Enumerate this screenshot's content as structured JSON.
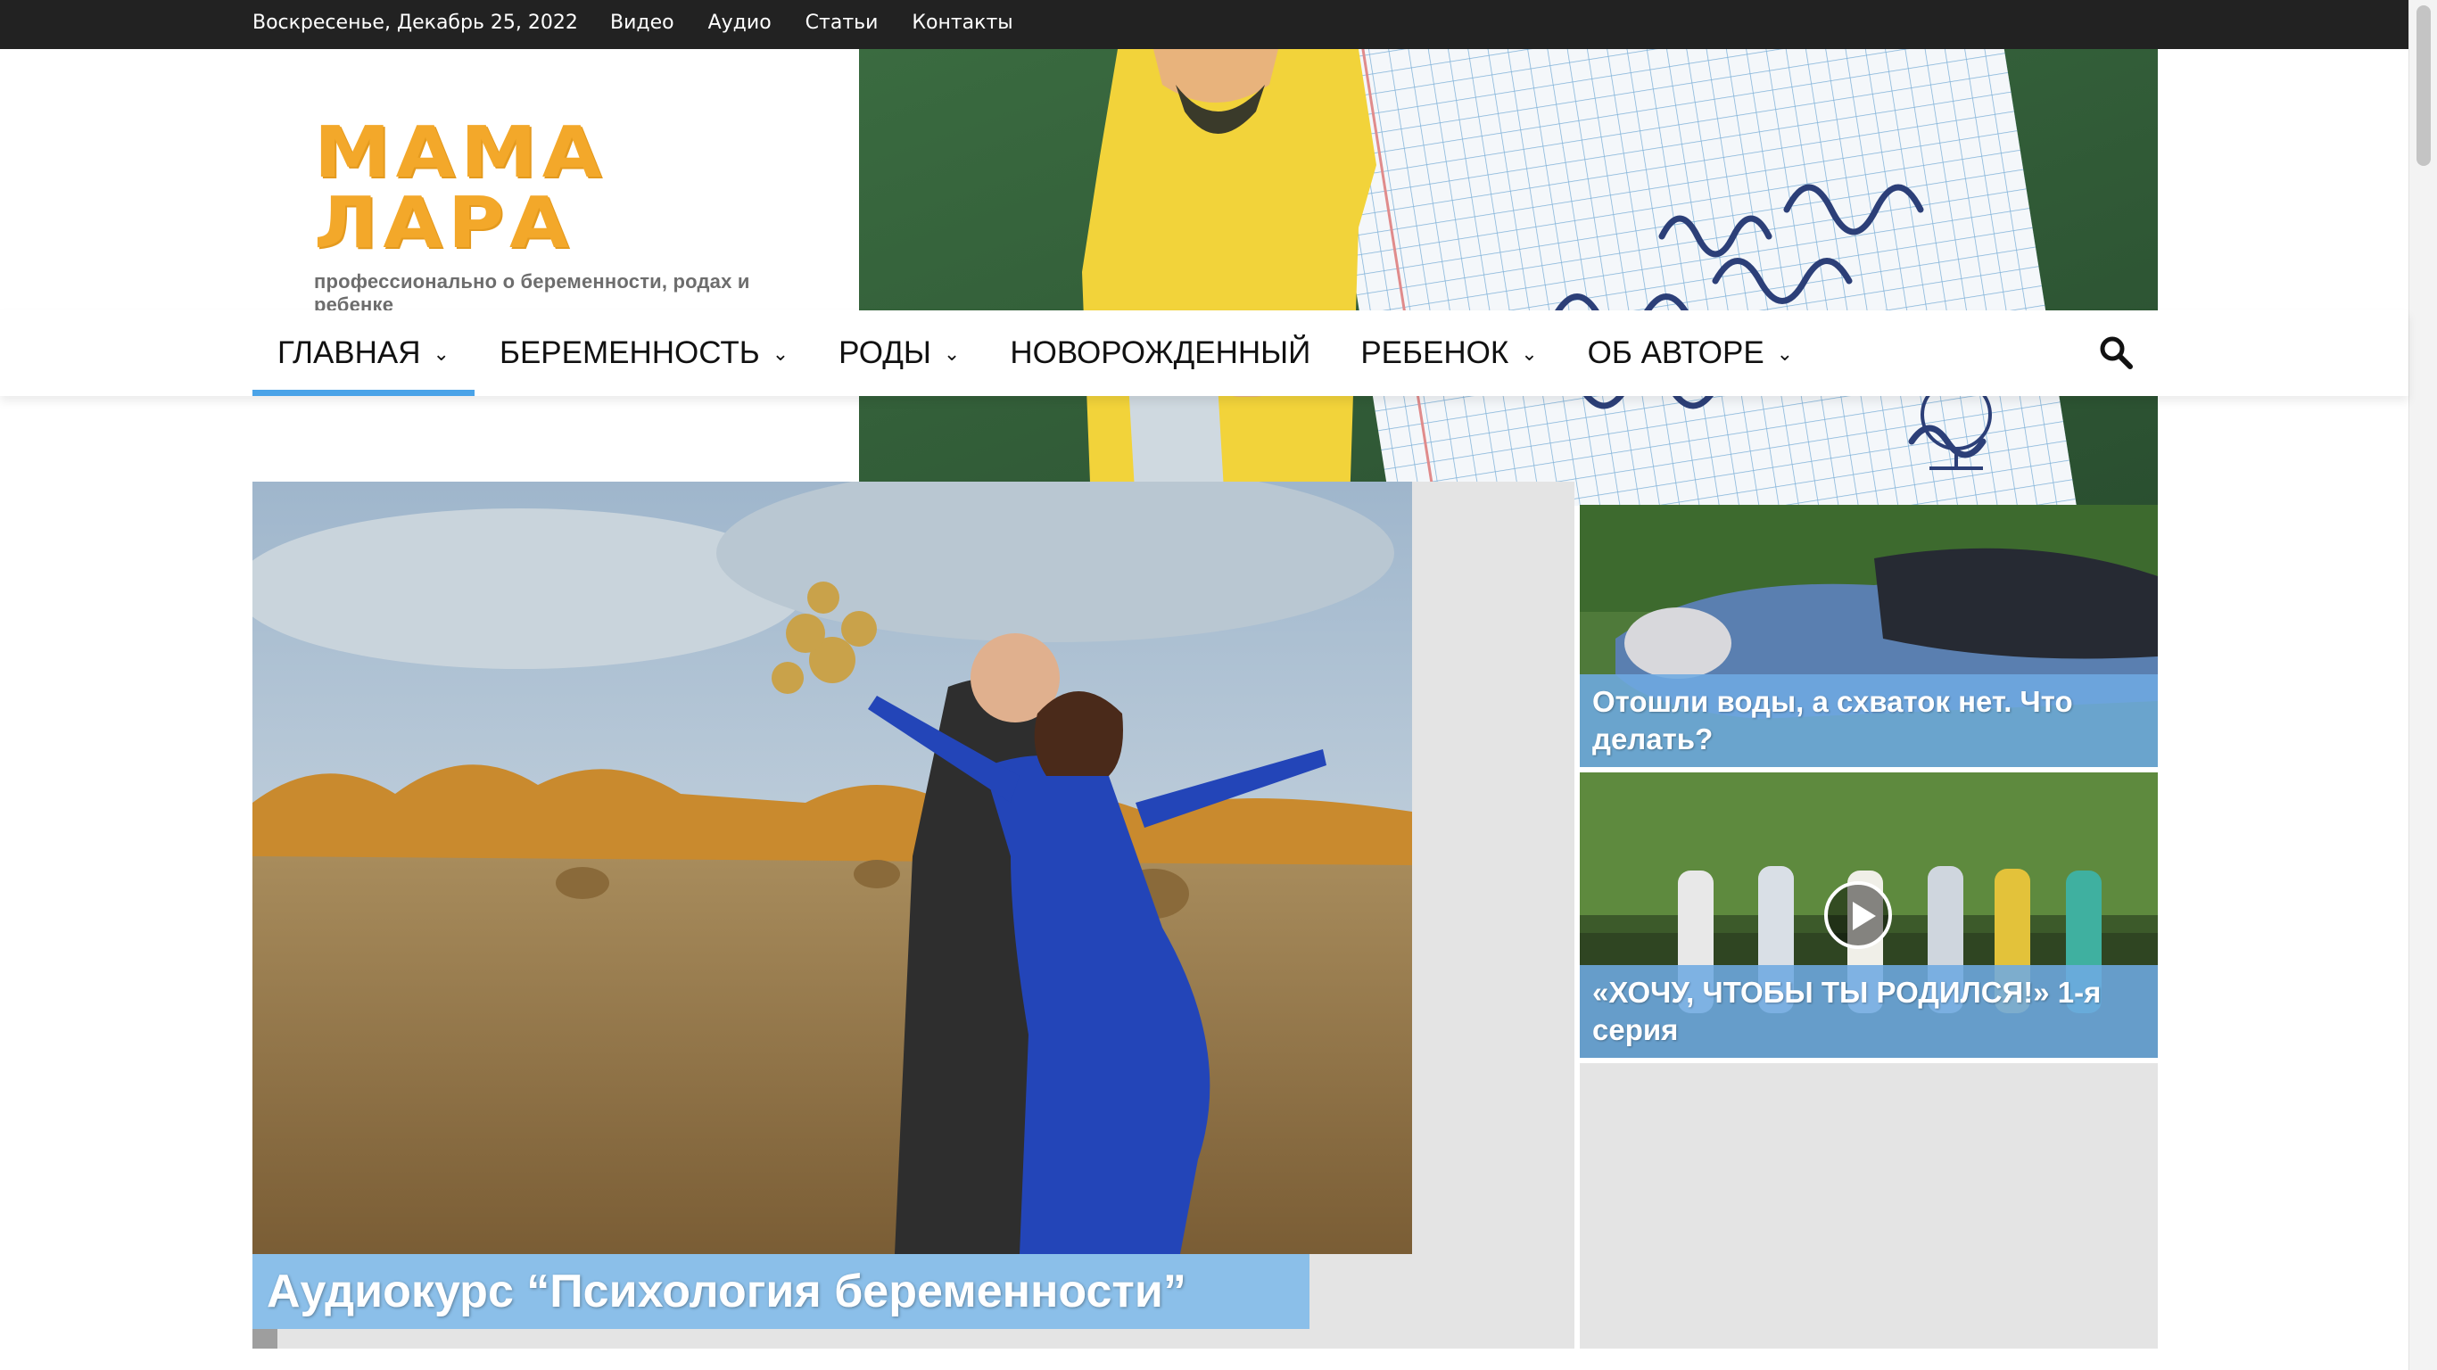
{
  "topbar": {
    "date": "Воскресенье, Декабрь 25, 2022",
    "links": [
      "Видео",
      "Аудио",
      "Статьи",
      "Контакты"
    ]
  },
  "logo": {
    "title": "МАМА ЛАРА",
    "subtitle": "профессионально о беременности, родах и ребенке"
  },
  "nav": {
    "items": [
      {
        "label": "ГЛАВНАЯ",
        "dropdown": true,
        "active": true
      },
      {
        "label": "БЕРЕМЕННОСТЬ",
        "dropdown": true
      },
      {
        "label": "РОДЫ",
        "dropdown": true
      },
      {
        "label": "НОВОРОЖДЕННЫЙ",
        "dropdown": false
      },
      {
        "label": "РЕБЕНОК",
        "dropdown": true
      },
      {
        "label": "ОБ АВТОРЕ",
        "dropdown": true
      }
    ],
    "search_icon": "search-icon"
  },
  "featured": {
    "main_title": "Аудиокурс “Психология беременности”",
    "side": [
      {
        "title": "Отошли воды, а схваток нет. Что делать?"
      },
      {
        "title": "«ХОЧУ, ЧТОБЫ ТЫ РОДИЛСЯ!» 1-я серия",
        "video": true
      }
    ]
  },
  "colors": {
    "accent": "#4aa3e8",
    "topbar": "#222222",
    "logo": "#f3a82a",
    "title_overlay": "#8bbfe9"
  }
}
